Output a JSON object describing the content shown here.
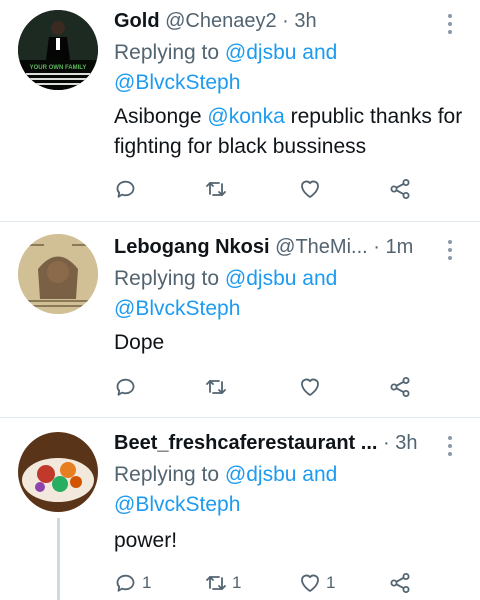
{
  "tweets": [
    {
      "name": "Gold",
      "handle": "@Chenaey2",
      "sep": "·",
      "time": "3h",
      "replying_prefix": "Replying to",
      "reply_to_1": "@djsbu",
      "reply_and": "and",
      "reply_to_2": "@BlvckSteph",
      "text_before": "Asibonge",
      "text_mention": "@konka",
      "text_after": "republic thanks for fighting for black bussiness",
      "avatar_text": "YOUR OWN FAMILY",
      "counts": {
        "reply": "",
        "retweet": "",
        "like": ""
      }
    },
    {
      "name": "Lebogang Nkosi",
      "handle": "@TheMi...",
      "sep": "·",
      "time": "1m",
      "replying_prefix": "Replying to",
      "reply_to_1": "@djsbu",
      "reply_and": "and",
      "reply_to_2": "@BlvckSteph",
      "text": "Dope",
      "counts": {
        "reply": "",
        "retweet": "",
        "like": ""
      }
    },
    {
      "name": "Beet_freshcaferestaurant ...",
      "sep": "·",
      "time": "3h",
      "replying_prefix": "Replying to",
      "reply_to_1": "@djsbu",
      "reply_and": "and",
      "reply_to_2": "@BlvckSteph",
      "text": "power!",
      "counts": {
        "reply": "1",
        "retweet": "1",
        "like": "1"
      }
    }
  ],
  "colors": {
    "link": "#1d9bf0",
    "secondary": "#536471",
    "icon": "#536471"
  }
}
